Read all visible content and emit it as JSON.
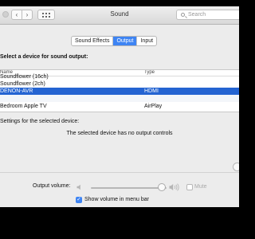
{
  "window": {
    "title": "Sound",
    "search_placeholder": "Search"
  },
  "tabs": [
    {
      "label": "Sound Effects"
    },
    {
      "label": "Output"
    },
    {
      "label": "Input"
    }
  ],
  "output": {
    "section_label": "Select a device for sound output:",
    "columns": {
      "name": "Name",
      "type": "Type"
    },
    "devices": [
      {
        "name": "Soundflower (16ch)",
        "type": ""
      },
      {
        "name": "Soundflower (2ch)",
        "type": ""
      },
      {
        "name": "DENON-AVR",
        "type": "HDMI"
      },
      {
        "name": "",
        "type": ""
      },
      {
        "name": "Bedroom Apple TV",
        "type": "AirPlay"
      }
    ],
    "settings_label": "Settings for the selected device:",
    "no_controls_message": "The selected device has no output controls"
  },
  "volume": {
    "label": "Output volume:",
    "level": 0.9,
    "mute_label": "Mute",
    "show_in_menubar_label": "Show volume in menu bar",
    "show_in_menubar_checked": true
  },
  "colors": {
    "accent": "#3e84f3",
    "selection": "#2464d2"
  },
  "icons": [
    "back-icon",
    "forward-icon",
    "grid-icon",
    "search-icon",
    "speaker-low-icon",
    "speaker-high-icon",
    "help-icon"
  ]
}
